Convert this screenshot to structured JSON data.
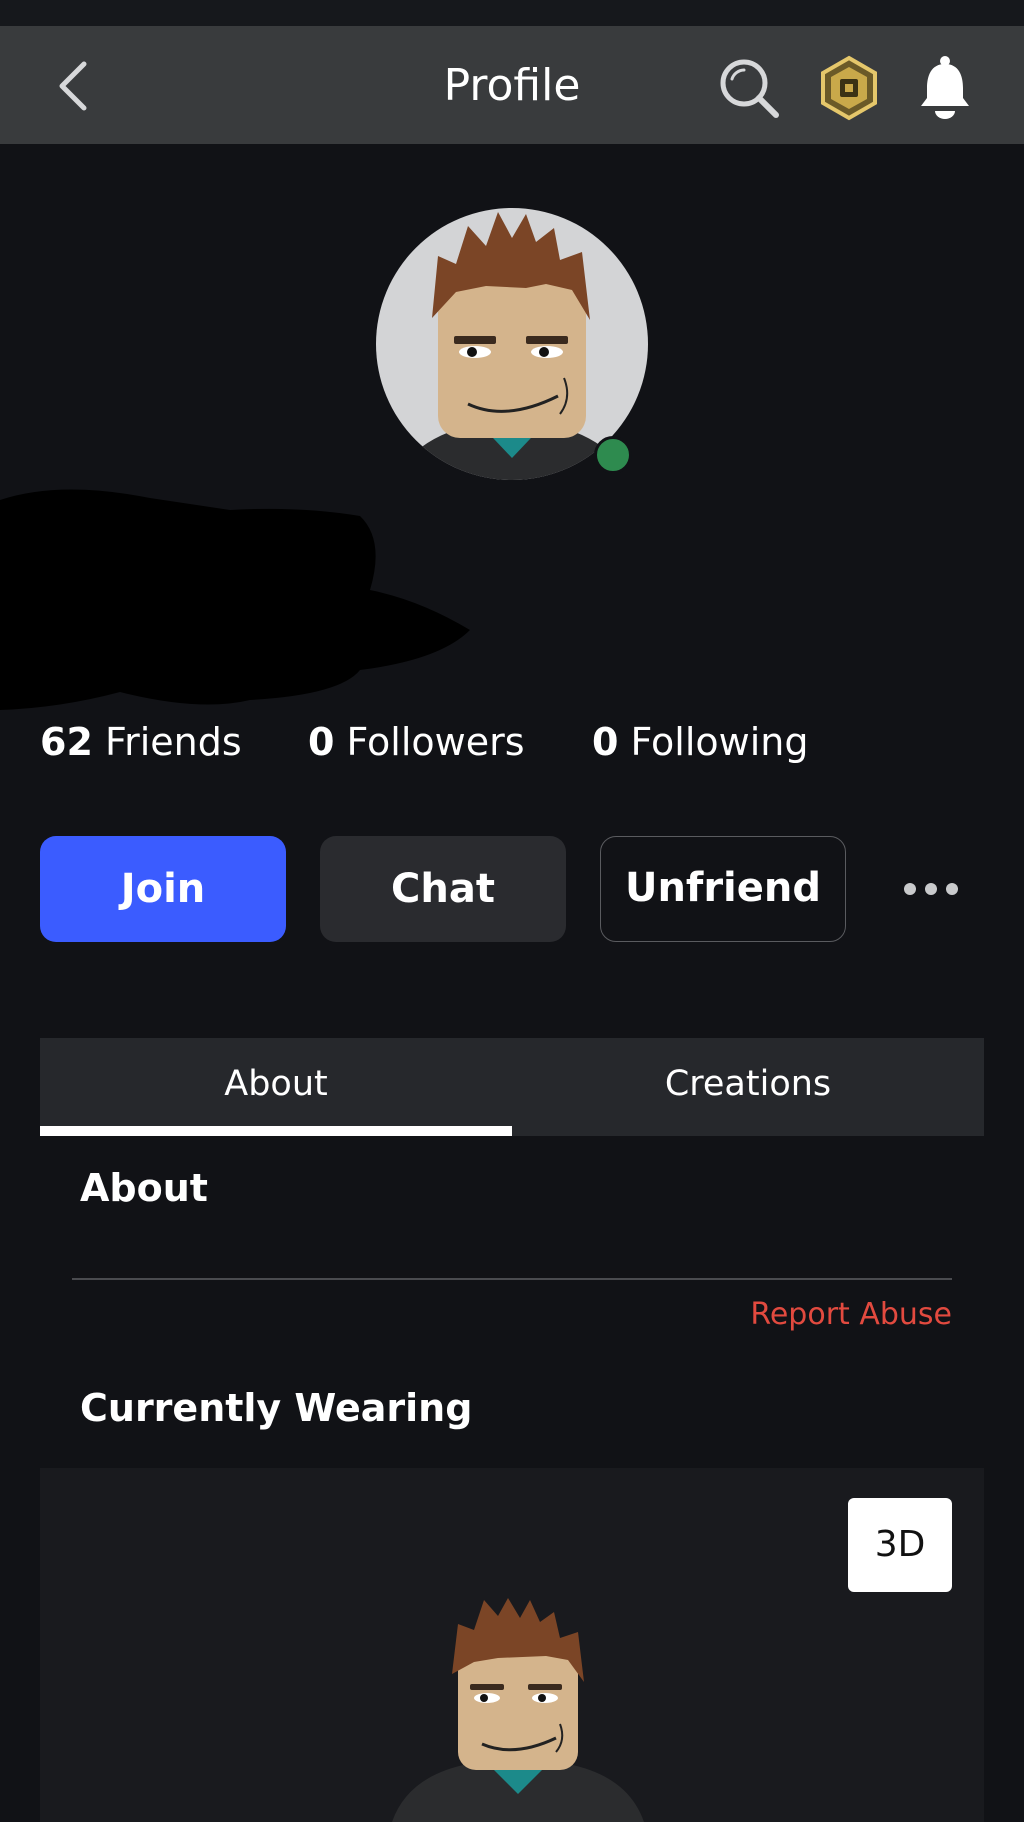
{
  "header": {
    "title": "Profile",
    "icons": [
      "back-arrow-icon",
      "search-icon",
      "robux-icon",
      "bell-icon"
    ]
  },
  "profile": {
    "presence_color": "#2e8b4f"
  },
  "stats": {
    "friends": {
      "count": "62",
      "label": "Friends"
    },
    "followers": {
      "count": "0",
      "label": "Followers"
    },
    "following": {
      "count": "0",
      "label": "Following"
    }
  },
  "actions": {
    "join_label": "Join",
    "chat_label": "Chat",
    "unfriend_label": "Unfriend",
    "more_icon": "more-dots-icon"
  },
  "tabs": [
    {
      "label": "About",
      "selected": true
    },
    {
      "label": "Creations",
      "selected": false
    }
  ],
  "about": {
    "heading": "About",
    "report_label": "Report Abuse"
  },
  "wearing": {
    "heading": "Currently Wearing",
    "view_3d_label": "3D"
  },
  "colors": {
    "background": "#111216",
    "header": "#393b3d",
    "join_button": "#3b5cff",
    "report_link": "#e24a3f"
  }
}
